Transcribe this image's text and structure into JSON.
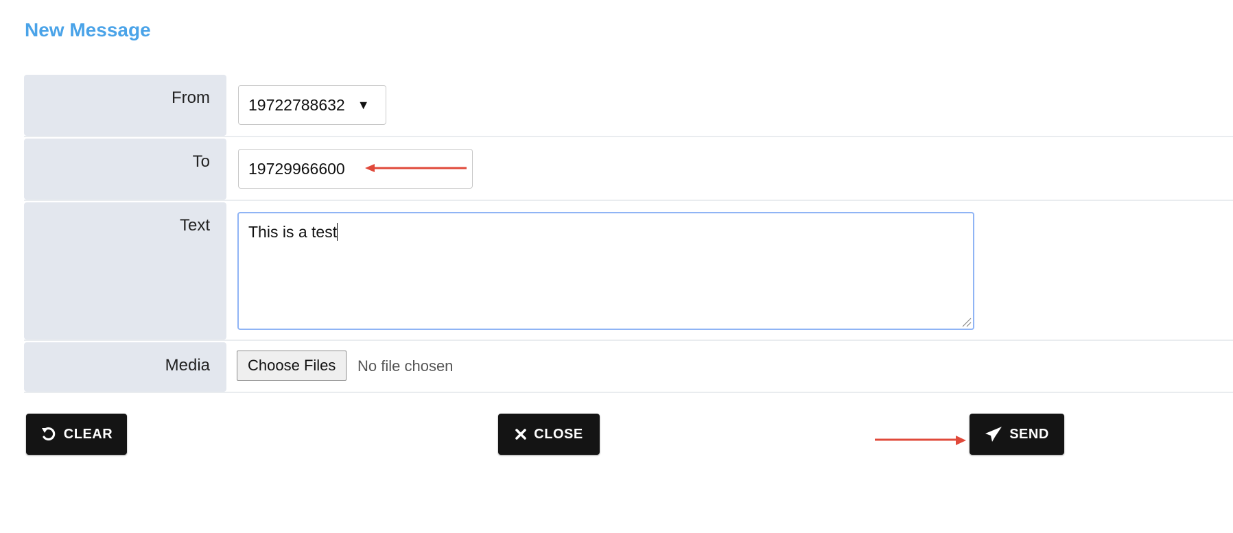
{
  "title": "New Message",
  "form": {
    "from": {
      "label": "From",
      "value": "19722788632"
    },
    "to": {
      "label": "To",
      "value": "19729966600"
    },
    "text": {
      "label": "Text",
      "value": "This is a test"
    },
    "media": {
      "label": "Media",
      "button_label": "Choose Files",
      "status": "No file chosen"
    }
  },
  "buttons": {
    "clear": "CLEAR",
    "close": "CLOSE",
    "send": "SEND"
  },
  "colors": {
    "title": "#4aa3e8",
    "button_bg": "#141414",
    "label_bg": "#e3e7ee",
    "focus_border": "#8fb4f5",
    "annotation_arrow": "#e0493a"
  },
  "icons": {
    "select": "dropdown-caret-icon",
    "clear": "undo-icon",
    "close": "close-icon",
    "send": "paper-plane-icon"
  }
}
